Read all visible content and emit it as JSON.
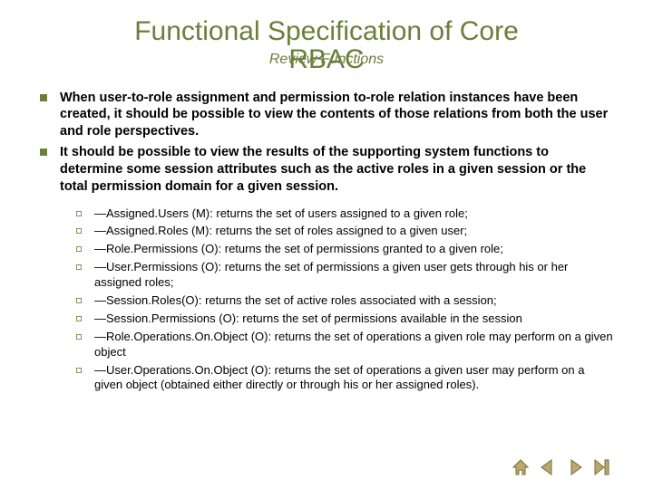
{
  "title": "Functional Specification of Core",
  "rbac": "RBAC",
  "review_label": "Review Functions",
  "bullets_l1": [
    "When user-to-role assignment and permission to-role relation instances have been created, it should be possible to view the contents of those relations from both the user and role perspectives.",
    "It should be possible to view the results of the supporting system functions to determine some session attributes such as the active roles in a given session or the total permission domain for a given session."
  ],
  "bullets_l2": [
    "—Assigned.Users (M): returns the set of users assigned to a given role;",
    "—Assigned.Roles (M): returns the set of roles assigned to a given user;",
    "—Role.Permissions (O): returns the set of permissions granted to a given role;",
    "—User.Permissions (O): returns the set of permissions a given user gets through his or her assigned roles;",
    "—Session.Roles(O): returns the set of active roles associated with a session;",
    "—Session.Permissions (O): returns the set of permissions available in the session",
    "—Role.Operations.On.Object (O): returns the set of operations a given role may perform on a given object",
    "—User.Operations.On.Object (O): returns the set of operations a given user may perform on a given object (obtained either directly or through his or her assigned roles)."
  ],
  "nav": {
    "home": "home-icon",
    "prev": "prev-icon",
    "next": "next-icon",
    "last": "last-icon"
  },
  "colors": {
    "heading": "#6a7f3a",
    "nav_fill": "#b9a96a",
    "nav_stroke": "#7a6a3a"
  }
}
